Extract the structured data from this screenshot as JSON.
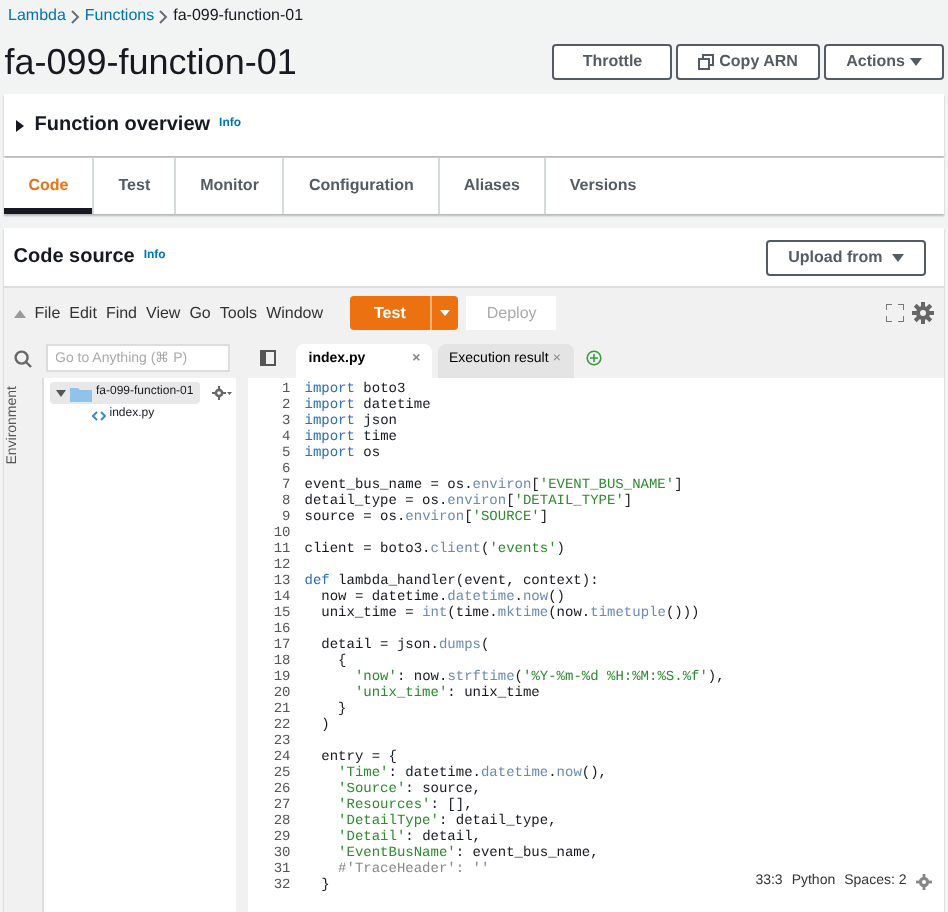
{
  "breadcrumbs": [
    {
      "label": "Lambda",
      "link": true
    },
    {
      "label": "Functions",
      "link": true
    },
    {
      "label": "fa-099-function-01",
      "link": false
    }
  ],
  "page_title": "fa-099-function-01",
  "header_buttons": [
    {
      "label": "Throttle",
      "kind": "plain"
    },
    {
      "label": "Copy ARN",
      "kind": "copy"
    },
    {
      "label": "Actions",
      "kind": "dropdown"
    }
  ],
  "overview": {
    "title": "Function overview",
    "info": "Info",
    "expanded": false
  },
  "tabs": [
    {
      "label": "Code",
      "selected": true
    },
    {
      "label": "Test",
      "selected": false
    },
    {
      "label": "Monitor",
      "selected": false
    },
    {
      "label": "Configuration",
      "selected": false
    },
    {
      "label": "Aliases",
      "selected": false
    },
    {
      "label": "Versions",
      "selected": false
    }
  ],
  "code_source": {
    "title": "Code source",
    "info": "Info",
    "upload_button": "Upload from"
  },
  "editor": {
    "menu": [
      "File",
      "Edit",
      "Find",
      "View",
      "Go",
      "Tools",
      "Window"
    ],
    "test_button": "Test",
    "deploy_button": {
      "label": "Deploy",
      "disabled": true
    },
    "search": {
      "placeholder": "Go to Anything (⌘ P)"
    },
    "environment_label": "Environment",
    "tree": [
      {
        "label": "fa-099-function-01",
        "kind": "folder",
        "expanded": true,
        "selected": true,
        "children": [
          {
            "label": "index.py",
            "kind": "file",
            "selected": false
          }
        ]
      }
    ],
    "file_tabs": [
      {
        "label": "index.py",
        "selected": true,
        "close": "×"
      },
      {
        "label": "Execution result",
        "selected": false,
        "close": "×"
      }
    ],
    "lines": [
      {
        "number": "1",
        "tokens": [
          {
            "kind": "kw",
            "text": "import"
          },
          {
            "kind": "plain",
            "text": " boto3"
          }
        ]
      },
      {
        "number": "2",
        "tokens": [
          {
            "kind": "kw",
            "text": "import"
          },
          {
            "kind": "plain",
            "text": " datetime"
          }
        ]
      },
      {
        "number": "3",
        "tokens": [
          {
            "kind": "kw",
            "text": "import"
          },
          {
            "kind": "plain",
            "text": " json"
          }
        ]
      },
      {
        "number": "4",
        "tokens": [
          {
            "kind": "kw",
            "text": "import"
          },
          {
            "kind": "plain",
            "text": " time"
          }
        ]
      },
      {
        "number": "5",
        "tokens": [
          {
            "kind": "kw",
            "text": "import"
          },
          {
            "kind": "plain",
            "text": " os"
          }
        ]
      },
      {
        "number": "6"
      },
      {
        "number": "7",
        "tokens": [
          {
            "kind": "plain",
            "text": "event_bus_name = os."
          },
          {
            "kind": "call",
            "text": "environ"
          },
          {
            "kind": "plain",
            "text": "["
          },
          {
            "kind": "str",
            "text": "'EVENT_BUS_NAME'"
          },
          {
            "kind": "plain",
            "text": "]"
          }
        ]
      },
      {
        "number": "8",
        "tokens": [
          {
            "kind": "plain",
            "text": "detail_type = os."
          },
          {
            "kind": "call",
            "text": "environ"
          },
          {
            "kind": "plain",
            "text": "["
          },
          {
            "kind": "str",
            "text": "'DETAIL_TYPE'"
          },
          {
            "kind": "plain",
            "text": "]"
          }
        ]
      },
      {
        "number": "9",
        "tokens": [
          {
            "kind": "plain",
            "text": "source = os."
          },
          {
            "kind": "call",
            "text": "environ"
          },
          {
            "kind": "plain",
            "text": "["
          },
          {
            "kind": "str",
            "text": "'SOURCE'"
          },
          {
            "kind": "plain",
            "text": "]"
          }
        ]
      },
      {
        "number": "10"
      },
      {
        "number": "11",
        "tokens": [
          {
            "kind": "plain",
            "text": "client = boto3."
          },
          {
            "kind": "call",
            "text": "client"
          },
          {
            "kind": "plain",
            "text": "("
          },
          {
            "kind": "str",
            "text": "'events'"
          },
          {
            "kind": "plain",
            "text": ")"
          }
        ]
      },
      {
        "number": "12"
      },
      {
        "number": "13",
        "tokens": [
          {
            "kind": "kw",
            "text": "def"
          },
          {
            "kind": "plain",
            "text": " lambda_handler(event, context):"
          }
        ]
      },
      {
        "number": "14",
        "tokens": [
          {
            "kind": "plain",
            "text": "  now = datetime."
          },
          {
            "kind": "call",
            "text": "datetime"
          },
          {
            "kind": "plain",
            "text": "."
          },
          {
            "kind": "call",
            "text": "now"
          },
          {
            "kind": "plain",
            "text": "()"
          }
        ]
      },
      {
        "number": "15",
        "tokens": [
          {
            "kind": "plain",
            "text": "  unix_time = "
          },
          {
            "kind": "call",
            "text": "int"
          },
          {
            "kind": "plain",
            "text": "(time."
          },
          {
            "kind": "call",
            "text": "mktime"
          },
          {
            "kind": "plain",
            "text": "(now."
          },
          {
            "kind": "call",
            "text": "timetuple"
          },
          {
            "kind": "plain",
            "text": "()))"
          }
        ]
      },
      {
        "number": "16"
      },
      {
        "number": "17",
        "tokens": [
          {
            "kind": "plain",
            "text": "  detail = json."
          },
          {
            "kind": "call",
            "text": "dumps"
          },
          {
            "kind": "plain",
            "text": "("
          }
        ]
      },
      {
        "number": "18",
        "tokens": [
          {
            "kind": "plain",
            "text": "    {"
          }
        ]
      },
      {
        "number": "19",
        "tokens": [
          {
            "kind": "str",
            "text": "      'now'"
          },
          {
            "kind": "plain",
            "text": ": now."
          },
          {
            "kind": "call",
            "text": "strftime"
          },
          {
            "kind": "plain",
            "text": "("
          },
          {
            "kind": "str",
            "text": "'%Y-%m-%d %H:%M:%S.%f'"
          },
          {
            "kind": "plain",
            "text": "),"
          }
        ]
      },
      {
        "number": "20",
        "tokens": [
          {
            "kind": "str",
            "text": "      'unix_time'"
          },
          {
            "kind": "plain",
            "text": ": unix_time"
          }
        ]
      },
      {
        "number": "21",
        "tokens": [
          {
            "kind": "plain",
            "text": "    }"
          }
        ]
      },
      {
        "number": "22",
        "tokens": [
          {
            "kind": "plain",
            "text": "  )"
          }
        ]
      },
      {
        "number": "23"
      },
      {
        "number": "24",
        "tokens": [
          {
            "kind": "plain",
            "text": "  entry = {"
          }
        ]
      },
      {
        "number": "25",
        "tokens": [
          {
            "kind": "str",
            "text": "    'Time'"
          },
          {
            "kind": "plain",
            "text": ": datetime."
          },
          {
            "kind": "call",
            "text": "datetime"
          },
          {
            "kind": "plain",
            "text": "."
          },
          {
            "kind": "call",
            "text": "now"
          },
          {
            "kind": "plain",
            "text": "(),"
          }
        ]
      },
      {
        "number": "26",
        "tokens": [
          {
            "kind": "str",
            "text": "    'Source'"
          },
          {
            "kind": "plain",
            "text": ": source,"
          }
        ]
      },
      {
        "number": "27",
        "tokens": [
          {
            "kind": "str",
            "text": "    'Resources'"
          },
          {
            "kind": "plain",
            "text": ": [],"
          }
        ]
      },
      {
        "number": "28",
        "tokens": [
          {
            "kind": "str",
            "text": "    'DetailType'"
          },
          {
            "kind": "plain",
            "text": ": detail_type,"
          }
        ]
      },
      {
        "number": "29",
        "tokens": [
          {
            "kind": "str",
            "text": "    'Detail'"
          },
          {
            "kind": "plain",
            "text": ": detail,"
          }
        ]
      },
      {
        "number": "30",
        "tokens": [
          {
            "kind": "str",
            "text": "    'EventBusName'"
          },
          {
            "kind": "plain",
            "text": ": event_bus_name,"
          }
        ]
      },
      {
        "number": "31",
        "tokens": [
          {
            "kind": "comment",
            "text": "    #'TraceHeader': ''"
          }
        ]
      },
      {
        "number": "32",
        "tokens": [
          {
            "kind": "plain",
            "text": "  }"
          }
        ]
      }
    ],
    "status": {
      "position": "33:3",
      "language": "Python",
      "indent": "Spaces: 2"
    }
  }
}
